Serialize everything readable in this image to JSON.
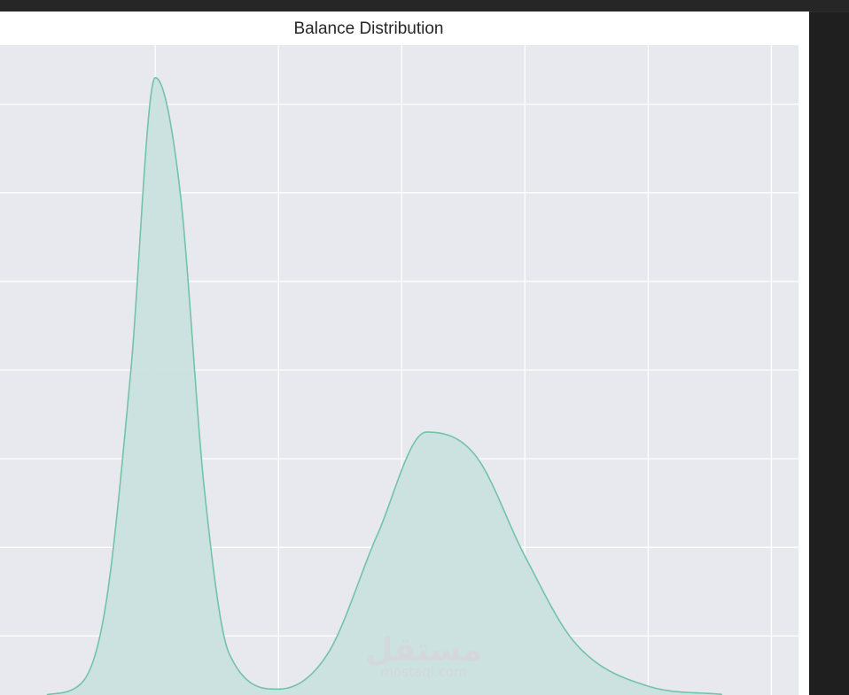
{
  "chart_data": {
    "type": "area",
    "title": "Balance Distribution",
    "xlabel": "",
    "ylabel": "",
    "grid": true,
    "xlim": [
      -2.15,
      14.05
    ],
    "ylim": [
      0,
      0.22
    ],
    "x_gridlines": [
      1,
      3.5,
      6,
      8.5,
      11,
      13.5
    ],
    "y_gridlines": [
      0.02,
      0.05,
      0.08,
      0.11,
      0.14,
      0.17,
      0.2
    ],
    "series": [
      {
        "x": [
          -1.2,
          -0.5,
          0,
          0.5,
          1,
          1.5,
          2,
          2.5,
          3.5,
          4.5,
          5.5,
          6.5,
          7.5,
          8.5,
          9.5,
          11,
          12.5
        ],
        "values": [
          0.0001,
          0.004,
          0.031,
          0.109,
          0.209,
          0.171,
          0.069,
          0.014,
          0.002,
          0.014,
          0.054,
          0.089,
          0.081,
          0.047,
          0.018,
          0.003,
          0.0002
        ]
      }
    ],
    "colors": {
      "line": "#72c4a6",
      "fill": "#c9e1df",
      "plot_background": "#e8e8ef",
      "grid": "#ffffff"
    }
  },
  "watermark": {
    "logo_text": "مستقل",
    "domain_text": "mostaql.com"
  }
}
